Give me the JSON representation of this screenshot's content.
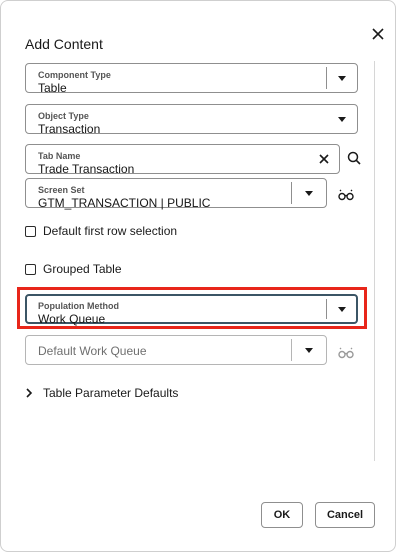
{
  "dialog": {
    "title": "Add Content",
    "close_icon": "close-icon"
  },
  "fields": {
    "component_type": {
      "label": "Component Type",
      "value": "Table"
    },
    "object_type": {
      "label": "Object Type",
      "value": "Transaction"
    },
    "tab_name": {
      "label": "Tab Name",
      "value": "Trade Transaction"
    },
    "screen_set": {
      "label": "Screen Set",
      "value": "GTM_TRANSACTION | PUBLIC"
    },
    "population_method": {
      "label": "Population Method",
      "value": "Work Queue"
    },
    "default_work_queue": {
      "placeholder": "Default Work Queue"
    }
  },
  "checkboxes": {
    "default_first_row": {
      "label": "Default first row selection",
      "checked": false
    },
    "grouped_table": {
      "label": "Grouped Table",
      "checked": false
    }
  },
  "section": {
    "table_parameter_defaults": "Table Parameter Defaults"
  },
  "buttons": {
    "ok": "OK",
    "cancel": "Cancel"
  },
  "icons": {
    "search": "search-icon",
    "glasses": "glasses-icon",
    "clear": "clear-icon",
    "dropdown": "chevron-down-icon",
    "expand": "chevron-right-icon"
  },
  "colors": {
    "highlight": "#e8261a",
    "focus_border": "#3b5565"
  }
}
